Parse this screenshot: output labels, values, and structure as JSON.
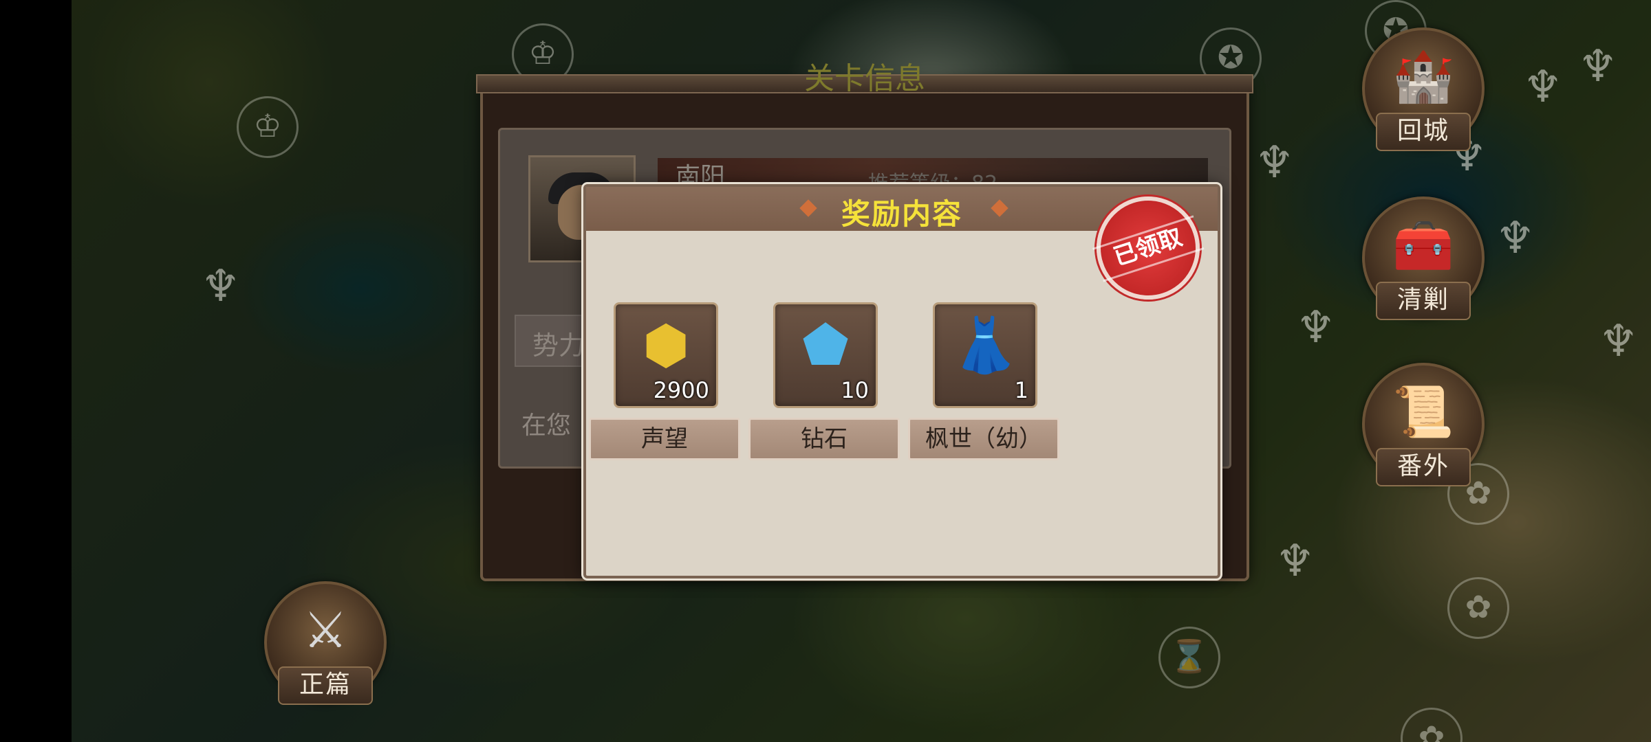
{
  "stage_info": {
    "title": "关卡信息",
    "stage_name": "南阳",
    "recommended_level": "推荐等级：82",
    "faction_label": "势力",
    "description_start": "在您"
  },
  "reward_dialog": {
    "title": "奖励内容",
    "claimed_stamp": "已领取",
    "items": [
      {
        "name": "声望",
        "count": "2900",
        "icon": "reputation-medal-icon"
      },
      {
        "name": "钻石",
        "count": "10",
        "icon": "diamond-crystal-icon"
      },
      {
        "name": "枫世（幼）",
        "count": "1",
        "icon": "costume-dress-icon"
      }
    ]
  },
  "side_buttons": {
    "return_city": "回城",
    "sweep": "清剿",
    "extra": "番外",
    "main_story": "正篇"
  },
  "colors": {
    "title_yellow": "#f5e23a",
    "stamp_red": "#d42e2e",
    "dialog_bg": "#dcd4c7",
    "header_brown": "#7a5d4a"
  }
}
